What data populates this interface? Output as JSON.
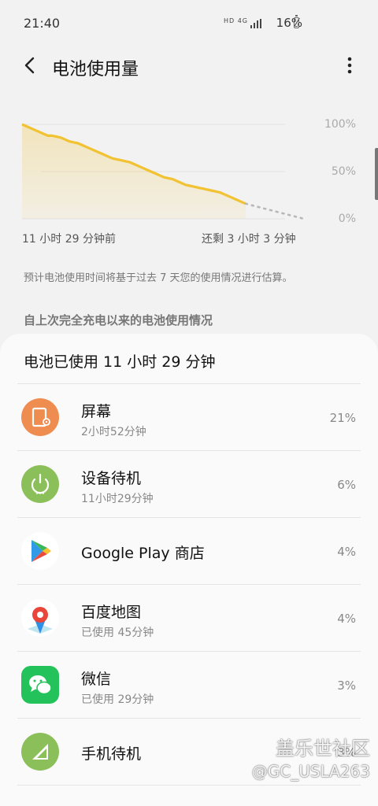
{
  "status_bar": {
    "time": "21:40",
    "network": "HD 4G",
    "battery_text": "16%",
    "battery_level": 0.16
  },
  "header": {
    "title": "电池使用量"
  },
  "chart_data": {
    "type": "area",
    "y_ticks": [
      "100%",
      "50%",
      "0%"
    ],
    "x_start_label": "11 小时 29 分钟前",
    "x_end_label": "还剩 3 小时 3 分钟",
    "actual_levels": [
      100,
      98,
      96,
      94,
      92,
      90,
      88,
      88,
      87,
      86,
      84,
      82,
      81,
      80,
      78,
      76,
      74,
      72,
      70,
      68,
      66,
      64,
      63,
      62,
      61,
      60,
      58,
      56,
      54,
      52,
      50,
      48,
      46,
      44,
      43,
      42,
      40,
      38,
      36,
      35,
      34,
      33,
      32,
      31,
      30,
      29,
      28,
      26,
      24,
      22,
      20,
      18,
      16
    ],
    "projected_levels": [
      16,
      0
    ],
    "series_color": "#f1c232",
    "ylim": [
      0,
      100
    ]
  },
  "estimate_note": "预计电池使用时间将基于过去 7 天您的使用情况进行估算。",
  "section_title": "自上次完全充电以来的电池使用情况",
  "card_title": "电池已使用 11 小时 29 分钟",
  "apps": [
    {
      "name": "屏幕",
      "detail": "2小时52分钟",
      "percent": "21%",
      "icon": "screen-icon",
      "color": "#ef8c50"
    },
    {
      "name": "设备待机",
      "detail": "11小时29分钟",
      "percent": "6%",
      "icon": "power-icon",
      "color": "#8bbf5a"
    },
    {
      "name": "Google Play 商店",
      "detail": "",
      "percent": "4%",
      "icon": "google-play-icon",
      "color": "#ffffff"
    },
    {
      "name": "百度地图",
      "detail": "已使用 45分钟",
      "percent": "4%",
      "icon": "baidu-map-icon",
      "color": "#ffffff"
    },
    {
      "name": "微信",
      "detail": "已使用 29分钟",
      "percent": "3%",
      "icon": "wechat-icon",
      "color": "#23c25a"
    },
    {
      "name": "手机待机",
      "detail": "",
      "percent": "3%",
      "icon": "phone-standby-icon",
      "color": "#8bbf5a"
    }
  ],
  "watermark": {
    "line1": "盖乐世社区",
    "line2": "@GC_USLA263"
  }
}
